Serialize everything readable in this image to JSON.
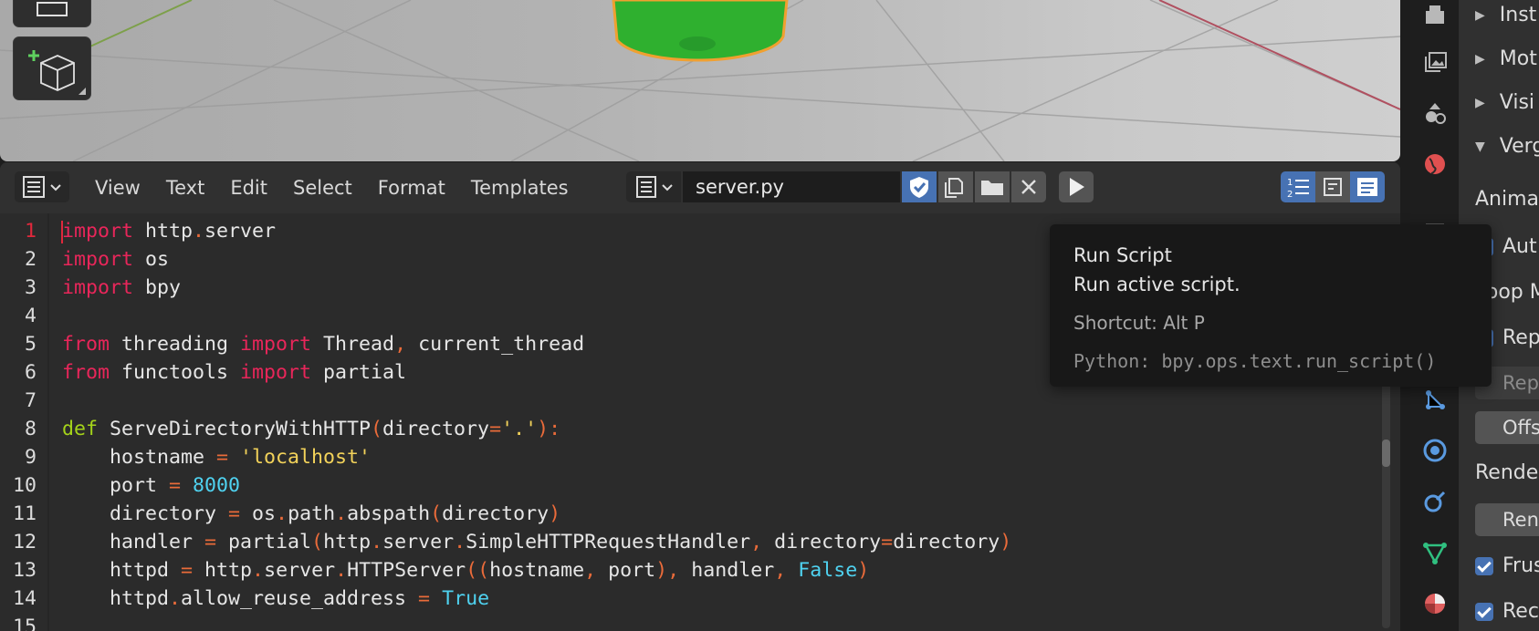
{
  "editor": {
    "menu": [
      "View",
      "Text",
      "Edit",
      "Select",
      "Format",
      "Templates"
    ],
    "file_name": "server.py"
  },
  "code": {
    "current_line": 1,
    "lines": [
      {
        "n": "1",
        "tokens": [
          {
            "c": "kw",
            "t": "import"
          },
          {
            "c": "",
            "t": " http"
          },
          {
            "c": "op",
            "t": "."
          },
          {
            "c": "",
            "t": "server"
          }
        ]
      },
      {
        "n": "2",
        "tokens": [
          {
            "c": "kw",
            "t": "import"
          },
          {
            "c": "",
            "t": " os"
          }
        ]
      },
      {
        "n": "3",
        "tokens": [
          {
            "c": "kw",
            "t": "import"
          },
          {
            "c": "",
            "t": " bpy"
          }
        ]
      },
      {
        "n": "4",
        "tokens": []
      },
      {
        "n": "5",
        "tokens": [
          {
            "c": "kw",
            "t": "from"
          },
          {
            "c": "",
            "t": " threading "
          },
          {
            "c": "kw",
            "t": "import"
          },
          {
            "c": "",
            "t": " Thread"
          },
          {
            "c": "op",
            "t": ","
          },
          {
            "c": "",
            "t": " current_thread"
          }
        ]
      },
      {
        "n": "6",
        "tokens": [
          {
            "c": "kw",
            "t": "from"
          },
          {
            "c": "",
            "t": " functools "
          },
          {
            "c": "kw",
            "t": "import"
          },
          {
            "c": "",
            "t": " partial"
          }
        ]
      },
      {
        "n": "7",
        "tokens": []
      },
      {
        "n": "8",
        "tokens": [
          {
            "c": "fn",
            "t": "def"
          },
          {
            "c": "",
            "t": " ServeDirectoryWithHTTP"
          },
          {
            "c": "op",
            "t": "("
          },
          {
            "c": "",
            "t": "directory"
          },
          {
            "c": "op",
            "t": "="
          },
          {
            "c": "st",
            "t": "'.'"
          },
          {
            "c": "op",
            "t": "):"
          }
        ]
      },
      {
        "n": "9",
        "tokens": [
          {
            "c": "",
            "t": "    hostname "
          },
          {
            "c": "op",
            "t": "="
          },
          {
            "c": "",
            "t": " "
          },
          {
            "c": "st",
            "t": "'localhost'"
          }
        ]
      },
      {
        "n": "10",
        "tokens": [
          {
            "c": "",
            "t": "    port "
          },
          {
            "c": "op",
            "t": "="
          },
          {
            "c": "",
            "t": " "
          },
          {
            "c": "nu",
            "t": "8000"
          }
        ]
      },
      {
        "n": "11",
        "tokens": [
          {
            "c": "",
            "t": "    directory "
          },
          {
            "c": "op",
            "t": "="
          },
          {
            "c": "",
            "t": " os"
          },
          {
            "c": "op",
            "t": "."
          },
          {
            "c": "",
            "t": "path"
          },
          {
            "c": "op",
            "t": "."
          },
          {
            "c": "",
            "t": "abspath"
          },
          {
            "c": "op",
            "t": "("
          },
          {
            "c": "",
            "t": "directory"
          },
          {
            "c": "op",
            "t": ")"
          }
        ]
      },
      {
        "n": "12",
        "tokens": [
          {
            "c": "",
            "t": "    handler "
          },
          {
            "c": "op",
            "t": "="
          },
          {
            "c": "",
            "t": " partial"
          },
          {
            "c": "op",
            "t": "("
          },
          {
            "c": "",
            "t": "http"
          },
          {
            "c": "op",
            "t": "."
          },
          {
            "c": "",
            "t": "server"
          },
          {
            "c": "op",
            "t": "."
          },
          {
            "c": "",
            "t": "SimpleHTTPRequestHandler"
          },
          {
            "c": "op",
            "t": ","
          },
          {
            "c": "",
            "t": " directory"
          },
          {
            "c": "op",
            "t": "="
          },
          {
            "c": "",
            "t": "directory"
          },
          {
            "c": "op",
            "t": ")"
          }
        ]
      },
      {
        "n": "13",
        "tokens": [
          {
            "c": "",
            "t": "    httpd "
          },
          {
            "c": "op",
            "t": "="
          },
          {
            "c": "",
            "t": " http"
          },
          {
            "c": "op",
            "t": "."
          },
          {
            "c": "",
            "t": "server"
          },
          {
            "c": "op",
            "t": "."
          },
          {
            "c": "",
            "t": "HTTPServer"
          },
          {
            "c": "op",
            "t": "(("
          },
          {
            "c": "",
            "t": "hostname"
          },
          {
            "c": "op",
            "t": ","
          },
          {
            "c": "",
            "t": " port"
          },
          {
            "c": "op",
            "t": "),"
          },
          {
            "c": "",
            "t": " handler"
          },
          {
            "c": "op",
            "t": ","
          },
          {
            "c": "",
            "t": " "
          },
          {
            "c": "nu",
            "t": "False"
          },
          {
            "c": "op",
            "t": ")"
          }
        ]
      },
      {
        "n": "14",
        "tokens": [
          {
            "c": "",
            "t": "    httpd"
          },
          {
            "c": "op",
            "t": "."
          },
          {
            "c": "",
            "t": "allow_reuse_address "
          },
          {
            "c": "op",
            "t": "="
          },
          {
            "c": "",
            "t": " "
          },
          {
            "c": "nu",
            "t": "True"
          }
        ]
      },
      {
        "n": "15",
        "tokens": []
      }
    ]
  },
  "tooltip": {
    "title": "Run Script",
    "description": "Run active script.",
    "shortcut": "Shortcut: Alt P",
    "python": "Python: bpy.ops.text.run_script()"
  },
  "properties": {
    "panels": [
      "Inst",
      "Mot",
      "Visi",
      "Verg"
    ],
    "animate_label": "Animat",
    "auto_label": "Aut",
    "loop_label": "Loop M",
    "repeat_label": "Rep",
    "repeat_disabled_label": "Rep",
    "offset_label": "Offs",
    "render_label": "Rende",
    "render_btn_label": "Ren",
    "frustum_label": "Frus",
    "rec_label": "Rec"
  },
  "colors": {
    "keyword": "#e8265a",
    "def": "#a4d31a",
    "string": "#f2d25a",
    "number": "#4fd2f0",
    "operator": "#ea6b3a",
    "accent": "#4772b3",
    "selected_object": "#2fb02f"
  }
}
